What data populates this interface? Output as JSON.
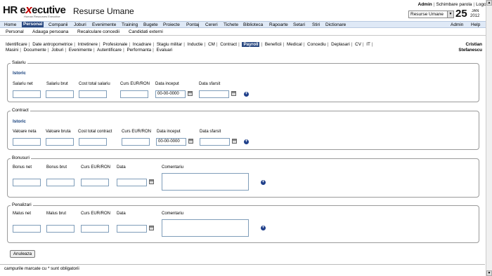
{
  "brand": {
    "logo_prefix": "HR e",
    "logo_x": "x",
    "logo_suffix": "ecutive",
    "logo_tagline": "Human Resources Executive",
    "title": "Resurse Umane"
  },
  "toplinks": {
    "admin": "Admin",
    "change_password": "Schimbare parola",
    "logout": "Logout"
  },
  "module_select": {
    "value": "Resurse Umane"
  },
  "date": {
    "day": "25",
    "month": "JAN",
    "year": "2012"
  },
  "mainmenu": [
    "Home",
    "Personal",
    "Companii",
    "Joburi",
    "Evenimente",
    "Training",
    "Bugete",
    "Proiecte",
    "Pontaj",
    "Cereri",
    "Tichete",
    "Biblioteca",
    "Rapoarte",
    "Setari",
    "Stiri",
    "Dictionare"
  ],
  "mainmenu_active": "Personal",
  "mainmenu_right": {
    "admin": "Admin",
    "help": "Help"
  },
  "submenu": [
    "Personal",
    "Adauga persoana",
    "Recalculare concedii",
    "Candidati externi"
  ],
  "tabs_row1": [
    "Identificare",
    "Date antropometrice",
    "Intretinere",
    "Profesionale",
    "Incadrare",
    "Stagiu militar",
    "Inductie",
    "CM",
    "Contract",
    "Payroll",
    "Beneficii",
    "Medical",
    "Concediu",
    "Deplasari",
    "CV",
    "IT"
  ],
  "tabs_row2": [
    "Masini",
    "Documente",
    "Joburi",
    "Evenimente",
    "Autentificare",
    "Performanta",
    "Evaluari"
  ],
  "tabs_active": "Payroll",
  "employee": {
    "first": "Cristian",
    "last": "Stefanescu"
  },
  "salariu": {
    "legend": "Salariu",
    "istoric": "Istoric",
    "labels": [
      "Salariu net",
      "Salariu brut",
      "Cost total salariu",
      "Curs EUR/RON",
      "Data inceput",
      "Data sfarsit"
    ],
    "date_value": "00-00-0000"
  },
  "contract": {
    "legend": "Contract",
    "istoric": "Istoric",
    "labels": [
      "Valoare neta",
      "Valoare bruta",
      "Cost total contract",
      "Curs EUR/RON",
      "Data inceput",
      "Data sfarsit"
    ],
    "date_value": "00-00-0000"
  },
  "bonusuri": {
    "legend": "Bonusuri",
    "labels": [
      "Bonus net",
      "Bonus brut",
      "Curs EUR/RON",
      "Data",
      "Comentariu"
    ]
  },
  "penalizari": {
    "legend": "Penalizari",
    "labels": [
      "Malus net",
      "Malus brut",
      "Curs EUR/RON",
      "Data",
      "Comentariu"
    ]
  },
  "cancel_button": "Anuleaza",
  "footer_note": "campurile marcate cu * sunt obligatorii",
  "colors": {
    "menu_bg": "#dfe9f6",
    "active": "#2b4a82",
    "plus": "#1f3f8a"
  }
}
